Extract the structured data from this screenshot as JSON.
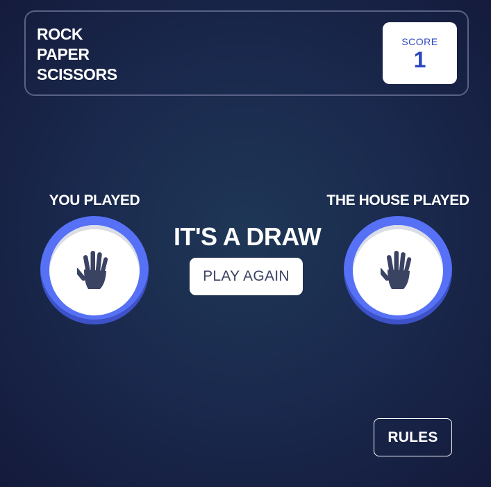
{
  "header": {
    "title_lines": [
      "ROCK",
      "PAPER",
      "SCISSORS"
    ],
    "score_label": "SCORE",
    "score_value": "1"
  },
  "game": {
    "you_label": "YOU PLAYED",
    "house_label": "THE HOUSE PLAYED",
    "result_text": "IT'S A DRAW",
    "play_again_label": "PLAY AGAIN",
    "you_choice": "paper",
    "house_choice": "paper",
    "you_icon": "paper-hand-icon",
    "house_icon": "paper-hand-icon"
  },
  "footer": {
    "rules_label": "RULES"
  },
  "colors": {
    "paper_gradient_outer": "#5671f5",
    "paper_gradient_shadow": "#3d52c8",
    "score_text": "#2a46c0",
    "dark_text": "#3b4363",
    "header_outline": "#5a6186",
    "background_center": "#1f3756",
    "background_edge": "#141a3b"
  }
}
